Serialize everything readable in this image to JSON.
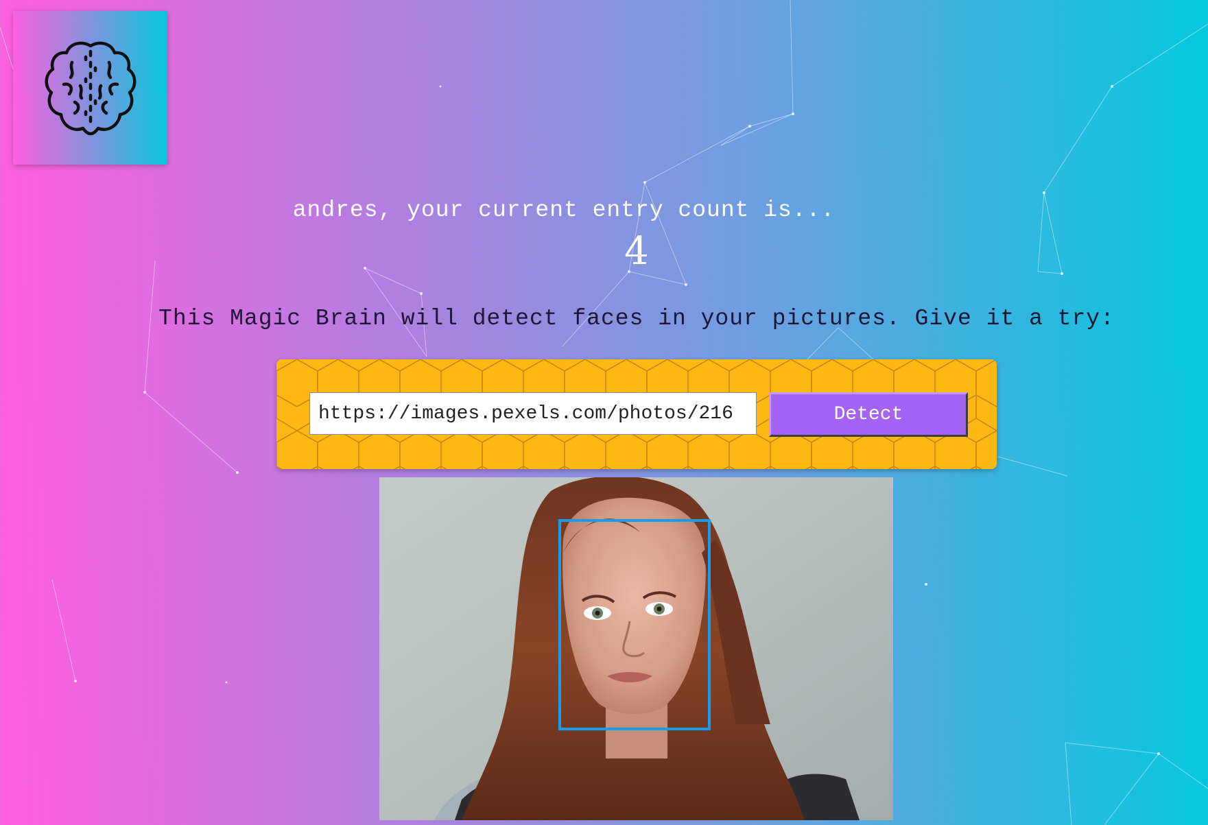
{
  "app": {
    "logo_icon": "brain-icon",
    "accent": "#a463f2",
    "form_background": "#fdb813",
    "face_box_color": "#149df2"
  },
  "rank": {
    "message": "andres, your current entry count is...",
    "entries": "4"
  },
  "intro": {
    "text": "This Magic Brain will detect faces in your pictures. Give it a try:"
  },
  "form": {
    "url_value": "https://images.pexels.com/photos/216",
    "detect_label": "Detect"
  },
  "result": {
    "faces_detected": 1
  }
}
